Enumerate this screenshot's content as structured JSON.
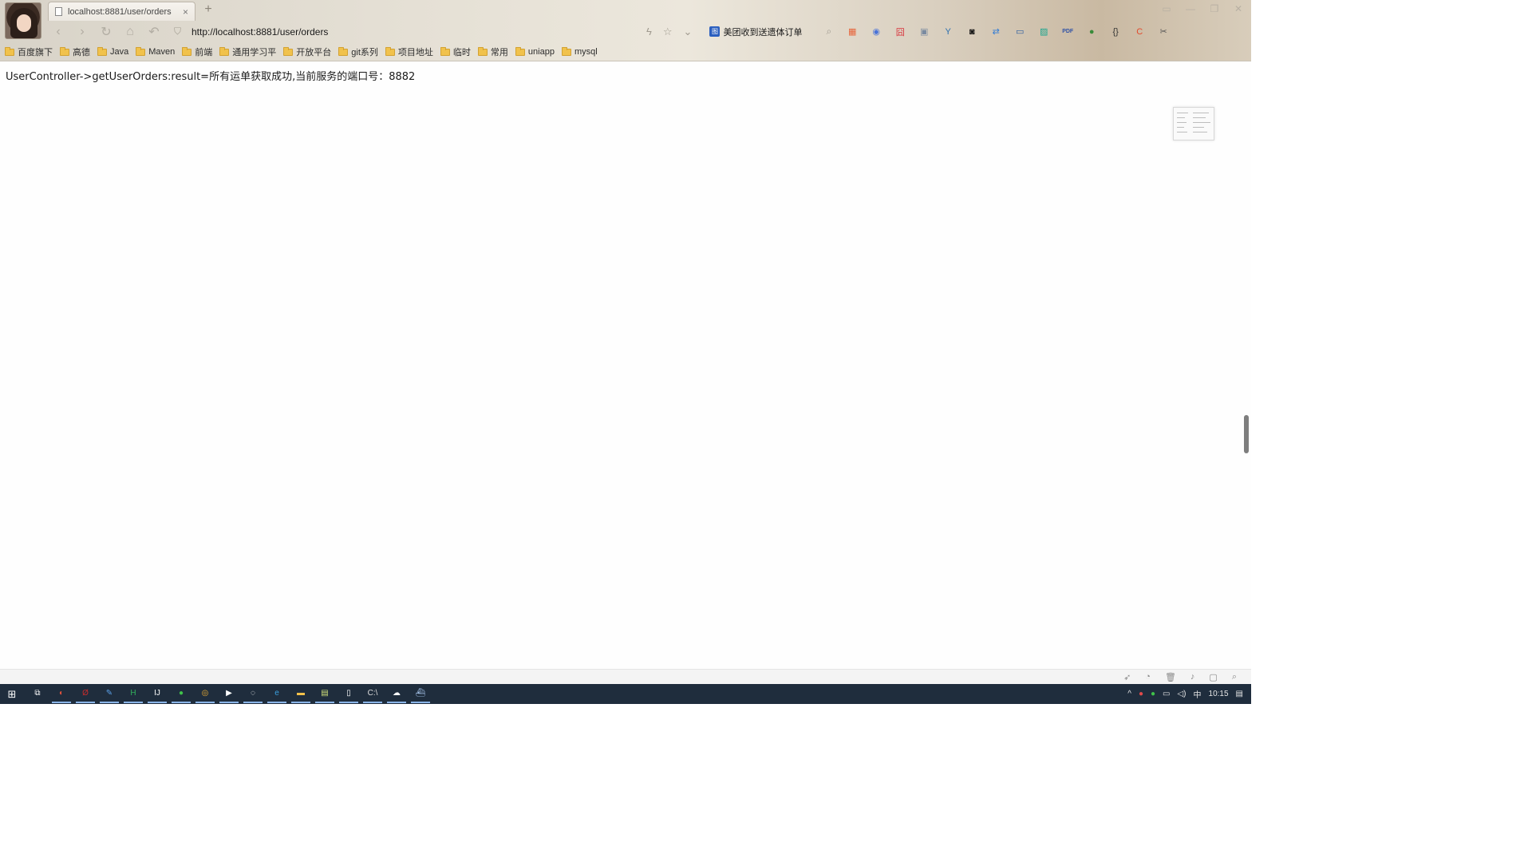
{
  "browser": {
    "tab_title": "localhost:8881/user/orders",
    "tab_close": "×",
    "new_tab": "+",
    "url": "http://localhost:8881/user/orders",
    "promo_text": "美团收到送遗体订单",
    "promo_badge": "图"
  },
  "bookmarks": [
    {
      "label": "百度旗下"
    },
    {
      "label": "高德"
    },
    {
      "label": "Java"
    },
    {
      "label": "Maven"
    },
    {
      "label": "前端"
    },
    {
      "label": "通用学习平"
    },
    {
      "label": "开放平台"
    },
    {
      "label": "git系列"
    },
    {
      "label": "项目地址"
    },
    {
      "label": "临时"
    },
    {
      "label": "常用"
    },
    {
      "label": "uniapp"
    },
    {
      "label": "mysql"
    }
  ],
  "page": {
    "result_text": "UserController->getUserOrders:result=所有运单获取成功,当前服务的端口号：8882"
  },
  "extensions": [
    {
      "icon": "windows-tile-icon",
      "glyph": "▦",
      "color": "#e7643a"
    },
    {
      "icon": "compass-icon",
      "glyph": "◉",
      "color": "#4a73d8"
    },
    {
      "icon": "red-app-icon",
      "glyph": "囧",
      "color": "#d8323a"
    },
    {
      "icon": "screenshot-icon",
      "glyph": "▣",
      "color": "#7a8aa0"
    },
    {
      "icon": "vue-icon",
      "glyph": "Y",
      "color": "#2a6fb0"
    },
    {
      "icon": "mask-icon",
      "glyph": "◙",
      "color": "#111111"
    },
    {
      "icon": "sync-icon",
      "glyph": "⇄",
      "color": "#2f7bd6"
    },
    {
      "icon": "monitor-icon",
      "glyph": "▭",
      "color": "#2f5fa0"
    },
    {
      "icon": "image-icon",
      "glyph": "▨",
      "color": "#1aa58e"
    },
    {
      "icon": "pdf-icon",
      "glyph": "PDF",
      "color": "#3153a6"
    },
    {
      "icon": "globe-icon",
      "glyph": "●",
      "color": "#3a8b3a"
    },
    {
      "icon": "braces-icon",
      "glyph": "{}",
      "color": "#333333"
    },
    {
      "icon": "c-app-icon",
      "glyph": "C",
      "color": "#e24a2c"
    },
    {
      "icon": "scissors-icon",
      "glyph": "✂",
      "color": "#555555"
    }
  ],
  "taskbar": {
    "time": "10:15",
    "ime": "中",
    "apps": [
      {
        "icon": "task-view-icon",
        "glyph": "⧉",
        "color": "#ffffff"
      },
      {
        "icon": "git-client-icon",
        "glyph": "◐",
        "color": "#e0513c"
      },
      {
        "icon": "filezilla-icon",
        "glyph": "Ø",
        "color": "#c72c2c"
      },
      {
        "icon": "feather-icon",
        "glyph": "✎",
        "color": "#5aa0e8"
      },
      {
        "icon": "hbuilder-icon",
        "glyph": "H",
        "color": "#31b15c"
      },
      {
        "icon": "intellij-icon",
        "glyph": "IJ",
        "color": "#ffffff"
      },
      {
        "icon": "wechat-icon",
        "glyph": "●",
        "color": "#40c24a"
      },
      {
        "icon": "chrome-icon",
        "glyph": "◎",
        "color": "#f2b233"
      },
      {
        "icon": "media-player-icon",
        "glyph": "▶",
        "color": "#ffffff"
      },
      {
        "icon": "chat-icon",
        "glyph": "◌",
        "color": "#ffffff"
      },
      {
        "icon": "edge-icon",
        "glyph": "e",
        "color": "#3aa0e0"
      },
      {
        "icon": "explorer-icon",
        "glyph": "▬",
        "color": "#f3c14b"
      },
      {
        "icon": "notepad-icon",
        "glyph": "▤",
        "color": "#cfe07a"
      },
      {
        "icon": "document-icon",
        "glyph": "▯",
        "color": "#ffffff"
      },
      {
        "icon": "terminal-icon",
        "glyph": "C:\\",
        "color": "#dddddd"
      },
      {
        "icon": "cloud-icon",
        "glyph": "☁",
        "color": "#ffffff"
      },
      {
        "icon": "ship-icon",
        "glyph": "⛴",
        "color": "#aac8f0"
      }
    ]
  }
}
